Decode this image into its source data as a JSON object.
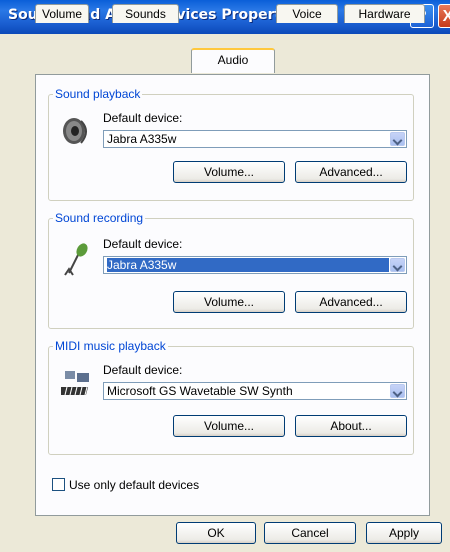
{
  "window": {
    "title": "Sounds and Audio Devices Properties",
    "help_label": "?",
    "close_label": "X"
  },
  "tabs": [
    {
      "label": "Volume"
    },
    {
      "label": "Sounds"
    },
    {
      "label": "Audio",
      "selected": true
    },
    {
      "label": "Voice"
    },
    {
      "label": "Hardware"
    }
  ],
  "sound_playback": {
    "legend": "Sound playback",
    "icon": "speaker-icon",
    "default_device_label": "Default device:",
    "device": "Jabra A335w",
    "volume_button": "Volume...",
    "advanced_button": "Advanced..."
  },
  "sound_recording": {
    "legend": "Sound recording",
    "icon": "microphone-icon",
    "default_device_label": "Default device:",
    "device": "Jabra A335w",
    "volume_button": "Volume...",
    "advanced_button": "Advanced..."
  },
  "midi_playback": {
    "legend": "MIDI music playback",
    "icon": "midi-keyboard-icon",
    "default_device_label": "Default device:",
    "device": "Microsoft GS Wavetable SW Synth",
    "volume_button": "Volume...",
    "about_button": "About..."
  },
  "use_default_only": {
    "label": "Use only default devices",
    "checked": false
  },
  "buttons": {
    "ok": "OK",
    "cancel": "Cancel",
    "apply": "Apply"
  },
  "colors": {
    "title_bar": "#0a5fd8",
    "selected_tab_accent": "#ffc83c",
    "group_legend": "#0046d5",
    "selection": "#316ac5"
  }
}
